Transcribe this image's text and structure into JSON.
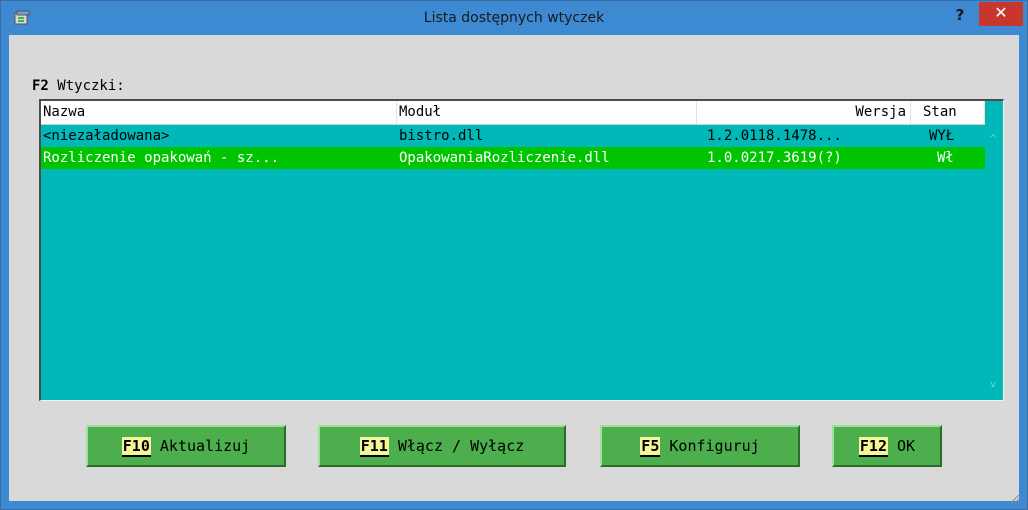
{
  "window": {
    "title": "Lista dostępnych wtyczek",
    "help_label": "?",
    "close_label": "✕"
  },
  "section": {
    "key": "F2",
    "label": " Wtyczki:"
  },
  "list": {
    "columns": [
      "Nazwa",
      "Moduł",
      "Wersja",
      "Stan"
    ],
    "rows": [
      {
        "name": "<niezaładowana>",
        "module": "bistro.dll",
        "version": "1.2.0118.1478...",
        "state": "WYŁ"
      },
      {
        "name": "Rozliczenie opakowań - sz...",
        "module": "OpakowaniaRozliczenie.dll",
        "version": "1.0.0217.3619(?)",
        "state": "Wł"
      }
    ],
    "selected_row": 1,
    "scroll_up": "^",
    "scroll_down": "v"
  },
  "buttons": {
    "update": {
      "key": "F10",
      "label": " Aktualizuj"
    },
    "toggle": {
      "key": "F11",
      "label": " Włącz / Wyłącz"
    },
    "configure": {
      "key": "F5",
      "label": " Konfiguruj"
    },
    "ok": {
      "key": "F12",
      "label": " OK"
    }
  },
  "colors": {
    "titlebar": "#3d8ad2",
    "list_background": "#00b8b8",
    "selected_row": "#00c400",
    "button": "#4cae4c",
    "fkey_highlight": "#f5f59a",
    "close_button": "#c7372e"
  },
  "icons": {
    "app": "app-icon",
    "resize": "resize-grip-icon"
  }
}
